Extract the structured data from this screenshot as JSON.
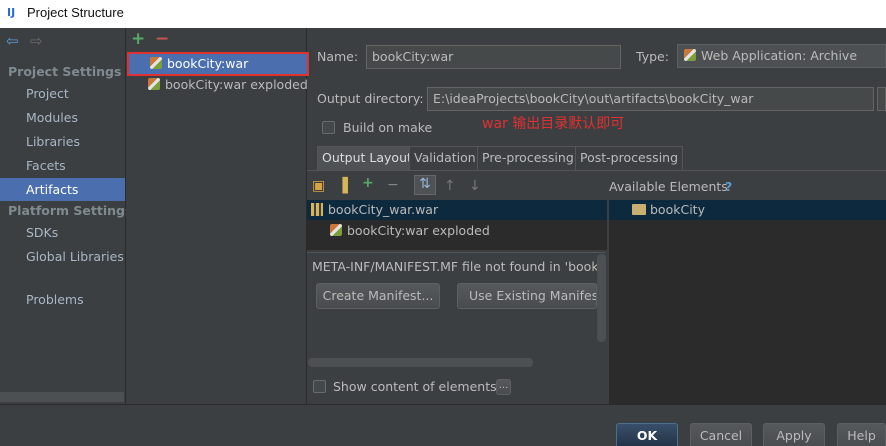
{
  "window": {
    "title": "Project Structure",
    "app_icon": "intellij-icon"
  },
  "left_nav": {
    "back_icon": "back-arrow-icon",
    "forward_icon": "forward-arrow-icon",
    "project_settings_title": "Project Settings",
    "project_settings_items": [
      "Project",
      "Modules",
      "Libraries",
      "Facets",
      "Artifacts"
    ],
    "platform_settings_title": "Platform Settings",
    "platform_settings_items": [
      "SDKs",
      "Global Libraries"
    ],
    "problems_label": "Problems",
    "active_item": "Artifacts"
  },
  "artifacts_list": {
    "add_icon": "+",
    "remove_icon": "−",
    "items": [
      "bookCity:war",
      "bookCity:war exploded"
    ],
    "selected": "bookCity:war"
  },
  "artifact_form": {
    "name_label": "Name:",
    "name_value": "bookCity:war",
    "type_label": "Type:",
    "type_value": "Web Application: Archive",
    "output_dir_label": "Output directory:",
    "output_dir_value": "E:\\ideaProjects\\bookCity\\out\\artifacts\\bookCity_war",
    "build_on_make_label": "Build on make",
    "build_on_make_checked": false,
    "annotation": "war 输出目录默认即可"
  },
  "tabs": [
    "Output Layout",
    "Validation",
    "Pre-processing",
    "Post-processing"
  ],
  "active_tab": "Output Layout",
  "output_layout": {
    "toolbar_icons": [
      "new-dir-icon",
      "archive-icon",
      "add-icon",
      "remove-icon",
      "sort-icon",
      "move-up-icon",
      "move-down-icon"
    ],
    "tree": [
      "bookCity_war.war",
      "bookCity:war exploded"
    ],
    "available_elements_label": "Available Elements",
    "help_icon": "?",
    "available_tree": [
      "bookCity"
    ],
    "manifest_message": "META-INF/MANIFEST.MF file not found in 'bookC",
    "create_manifest_label": "Create Manifest...",
    "use_existing_manifest_label": "Use Existing Manifest...",
    "show_content_label": "Show content of elements",
    "show_content_checked": false,
    "more_button_label": "..."
  },
  "footer": {
    "ok_label": "OK",
    "cancel_label": "Cancel",
    "apply_label": "Apply",
    "help_label": "Help"
  },
  "colors": {
    "accent_selection": "#4b6eaf",
    "annotation_red": "#e03030",
    "background": "#3c3f41"
  }
}
